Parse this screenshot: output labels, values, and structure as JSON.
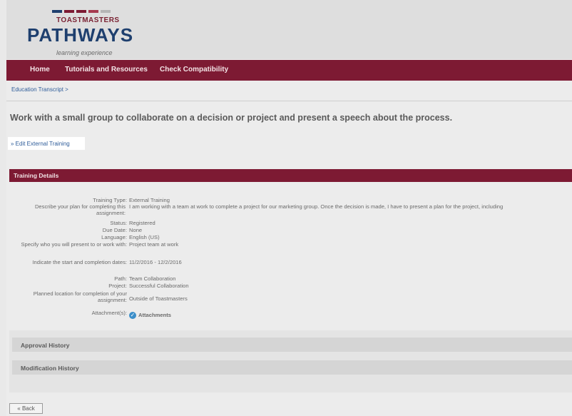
{
  "header": {
    "logo_top": "TOASTMASTERS",
    "logo_main": "PATHWAYS",
    "logo_sub": "learning experience",
    "logo_bar_colors": [
      "#1e3f6e",
      "#7d1a33",
      "#7d1a33",
      "#a63a4f",
      "#b5b5b5"
    ]
  },
  "nav": {
    "items": [
      {
        "label": "Home"
      },
      {
        "label": "Tutorials and Resources"
      },
      {
        "label": "Check Compatibility"
      }
    ]
  },
  "breadcrumb": "Education Transcript  >",
  "page_title": "Work with a small group to collaborate on a decision or project and present a speech about the process.",
  "edit_link": "» Edit External Training",
  "section_title": "Training Details",
  "details": [
    {
      "label": "Training Type:",
      "value": "External Training"
    },
    {
      "label": "Describe your plan for completing this assignment:",
      "value": "I am working with a team at work to complete a project for our marketing group. Once the decision is made, I have to present a plan for the project, including"
    },
    {
      "label": "Status:",
      "value": "Registered"
    },
    {
      "label": "Due Date:",
      "value": "None"
    },
    {
      "label": "Language:",
      "value": "English (US)"
    },
    {
      "label": "Specify who you will present to or work with:",
      "value": "Project team at work"
    },
    {
      "label": "Indicate the start and completion dates:",
      "value": "11/2/2016 - 12/2/2016"
    },
    {
      "label": "Path:",
      "value": "Team Collaboration"
    },
    {
      "label": "Project:",
      "value": "Successful Collaboration"
    },
    {
      "label": "Planned location for completion of your assignment:",
      "value": "Outside of Toastmasters"
    },
    {
      "label": "Attachment(s):",
      "value": "Attachments"
    }
  ],
  "panels": [
    {
      "title": "Approval History"
    },
    {
      "title": "Modification History"
    }
  ],
  "back_button": "« Back"
}
